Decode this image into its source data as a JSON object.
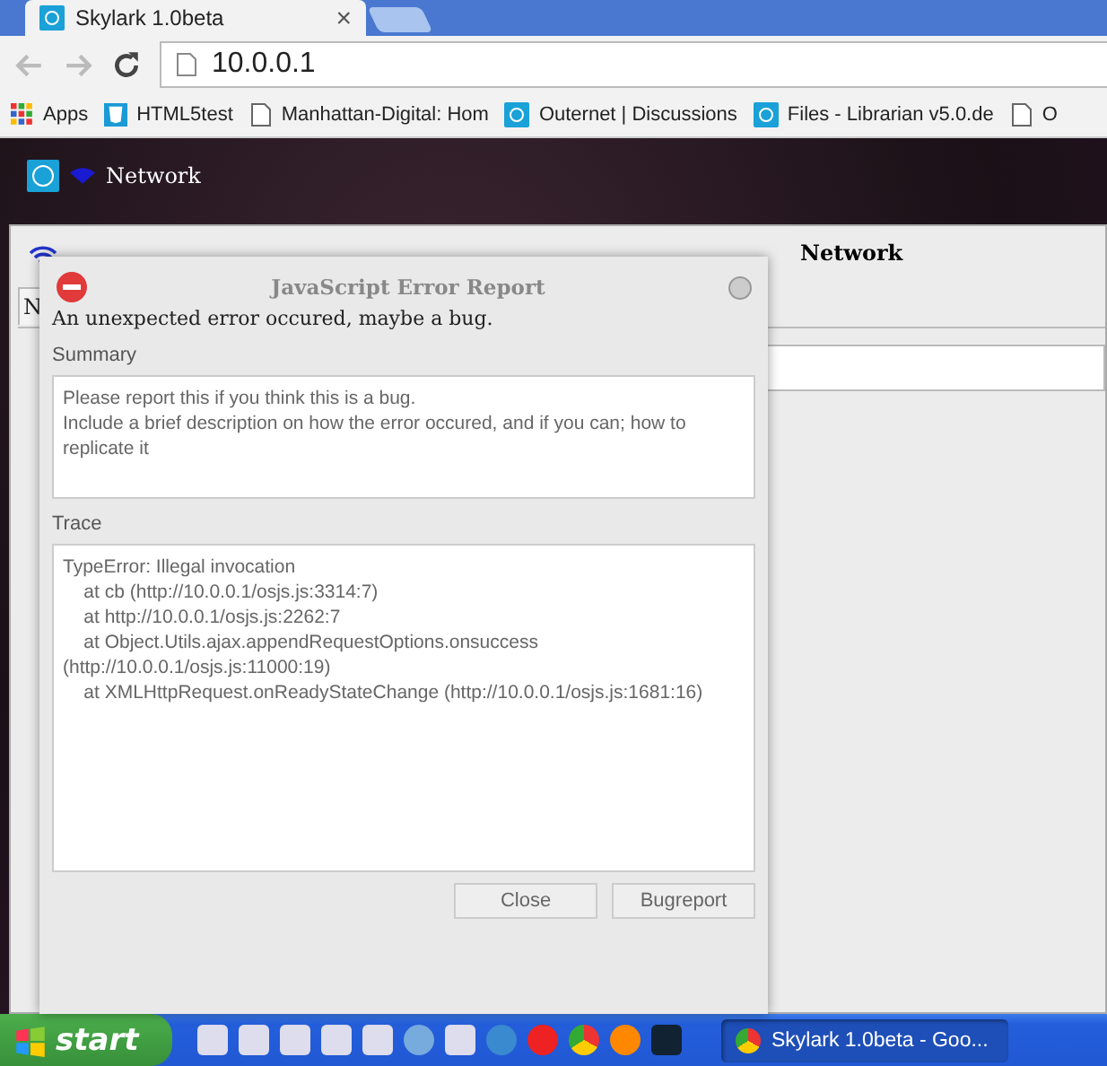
{
  "browser": {
    "tabs": [
      {
        "title": "Skylark 1.0beta",
        "close": "×",
        "selected": true
      }
    ],
    "address": "10.0.0.1",
    "bookmarks": [
      {
        "label": "Apps",
        "kind": "apps"
      },
      {
        "label": "HTML5test",
        "kind": "html5"
      },
      {
        "label": "Manhattan-Digital: Hom",
        "kind": "page"
      },
      {
        "label": "Outernet | Discussions",
        "kind": "ring"
      },
      {
        "label": "Files - Librarian v5.0.de",
        "kind": "ring"
      },
      {
        "label": "O",
        "kind": "page"
      }
    ]
  },
  "desktop_bar": {
    "label": "Network"
  },
  "app_window": {
    "title": "Network",
    "tabs": [
      {
        "label": "N",
        "selected": true
      }
    ]
  },
  "dialog": {
    "title": "JavaScript Error Report",
    "message": "An unexpected error occured, maybe a bug.",
    "summary_label": "Summary",
    "summary_text": "Please report this if you think this is a bug.\nInclude a brief description on how the error occured, and if you can; how to replicate it",
    "trace_label": "Trace",
    "trace_text": "TypeError: Illegal invocation\n    at cb (http://10.0.0.1/osjs.js:3314:7)\n    at http://10.0.0.1/osjs.js:2262:7\n    at Object.Utils.ajax.appendRequestOptions.onsuccess (http://10.0.0.1/osjs.js:11000:19)\n    at XMLHttpRequest.onReadyStateChange (http://10.0.0.1/osjs.js:1681:16)",
    "buttons": [
      "Close",
      "Bugreport"
    ]
  },
  "taskbar": {
    "start": "start",
    "tasks": [
      {
        "label": "Skylark 1.0beta - Goo...",
        "selected": true
      }
    ]
  }
}
